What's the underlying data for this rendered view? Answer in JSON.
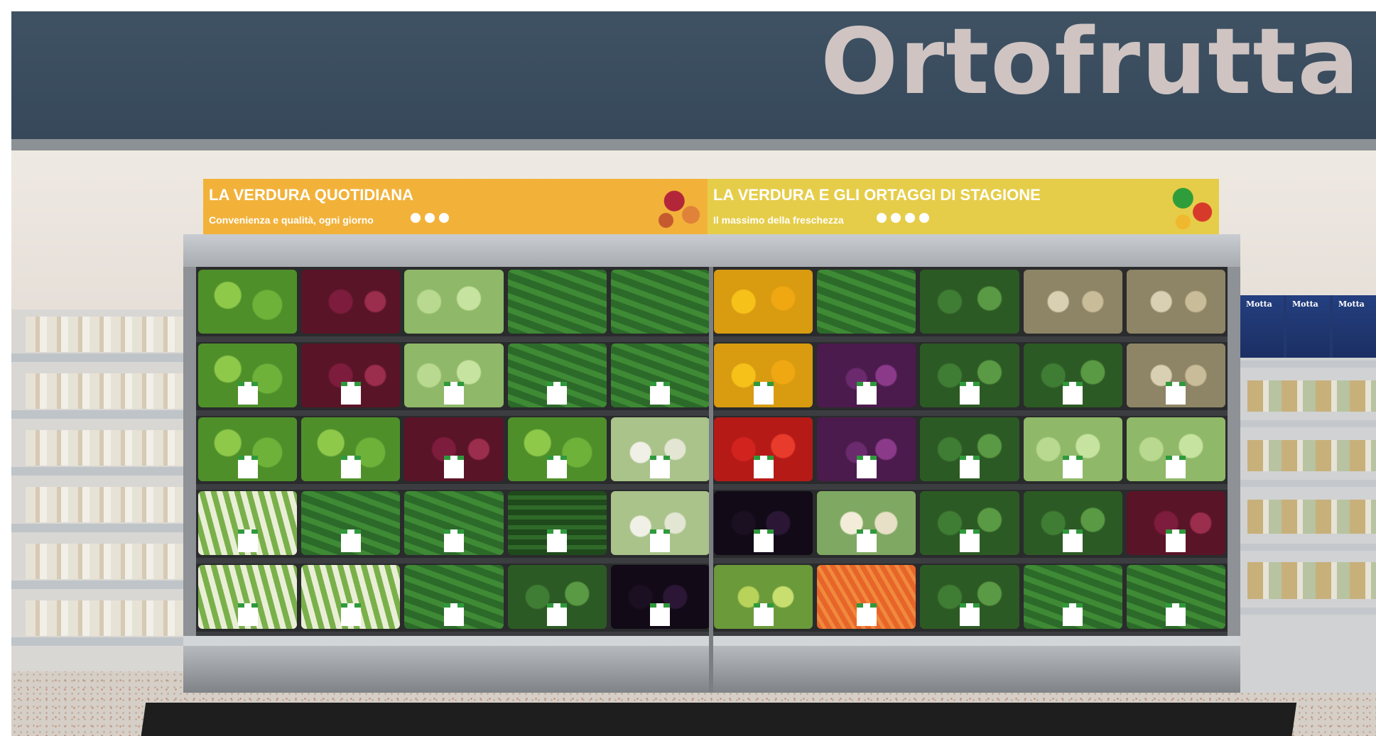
{
  "header": {
    "store_sign": "Ortofrutta"
  },
  "signs": [
    {
      "title": "LA VERDURA QUOTIDIANA",
      "subtitle": "Convenienza e qualità, ogni giorno",
      "color": "#f2b23a"
    },
    {
      "title": "LA VERDURA E GLI ORTAGGI DI STAGIONE",
      "subtitle": "Il massimo della freschezza",
      "color": "#e6cd49"
    }
  ],
  "side_products": {
    "right_brand": "Motta"
  },
  "colors": {
    "ceiling": "#3f5263",
    "sign_text": "#cfc4c2",
    "case_frame": "#8e9196",
    "italian_flag_green": "#2f9a3c"
  },
  "case_rows": [
    [
      "veg-lettuce",
      "veg-radicchio",
      "veg-cabbage",
      "veg-greens",
      "veg-greens",
      "veg-pepper-y",
      "veg-greens",
      "veg-broccoli",
      "veg-celeriac",
      "veg-celeriac"
    ],
    [
      "veg-lettuce",
      "veg-radicchio",
      "veg-cabbage",
      "veg-greens",
      "veg-greens",
      "veg-pepper-y",
      "veg-onion",
      "veg-broccoli",
      "veg-broccoli",
      "veg-celeriac"
    ],
    [
      "veg-lettuce",
      "veg-lettuce",
      "veg-radicchio",
      "veg-lettuce",
      "veg-fennel",
      "veg-pepper-r",
      "veg-onion",
      "veg-broccoli",
      "veg-cabbage",
      "veg-cabbage"
    ],
    [
      "veg-leek",
      "veg-greens",
      "veg-greens",
      "veg-zucchini",
      "veg-fennel",
      "veg-eggplant",
      "veg-cauli",
      "veg-broccoli",
      "veg-broccoli",
      "veg-radicchio"
    ],
    [
      "veg-leek",
      "veg-leek",
      "veg-greens",
      "veg-broccoli",
      "veg-eggplant",
      "veg-romanesco",
      "veg-carrot",
      "veg-broccoli",
      "veg-greens",
      "veg-greens"
    ]
  ]
}
